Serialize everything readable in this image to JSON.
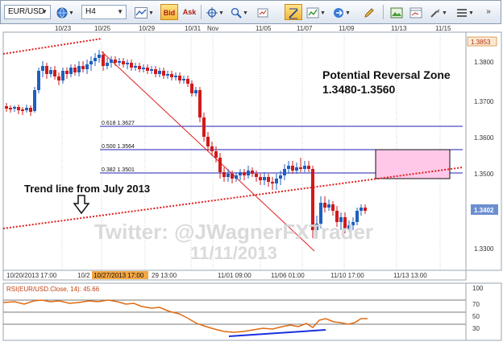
{
  "toolbar": {
    "symbol": "EUR/USD",
    "timeframe": "H4",
    "bid_label": "Bid",
    "ask_label": "Ask"
  },
  "top_dates": [
    "10/23",
    "10/25",
    "10/29",
    "10/31",
    "Nov",
    "11/05",
    "11/07",
    "11/09",
    "11/13",
    "11/15"
  ],
  "price_axis": {
    "labels": [
      "1.3853",
      "1.3800",
      "1.3700",
      "1.3600",
      "1.3500",
      "1.3402",
      "1.3300"
    ],
    "current": "1.3402"
  },
  "bottom_dates": [
    "10/20/2013 17:00",
    "10/2",
    "10/27/2013 17:00",
    "29 13:00",
    "11/01 09:00",
    "11/06 01:00",
    "11/10 17:00",
    "11/13 13:00"
  ],
  "annotations": {
    "zone_title": "Potential Reversal Zone",
    "zone_range": "1.3480-1.3560",
    "trend_label": "Trend line from July 2013",
    "watermark_line1": "Twitter: @JWagnerFXTrader",
    "watermark_line2": "11/11/2013"
  },
  "fib_levels": [
    {
      "label": "0.618  1.3627"
    },
    {
      "label": "0.500  1.3564"
    },
    {
      "label": "0.382  1.3501"
    }
  ],
  "rsi": {
    "label": "RSI(EUR/USD.Close, 14): 45.66",
    "axis_labels": [
      "100",
      "70",
      "50",
      "30"
    ]
  },
  "colors": {
    "up_candle": "#1f5fbf",
    "down_candle": "#d11a1a",
    "fib_line": "#1f1fb5",
    "zone_fill": "#ffc8e8",
    "trend_dotted": "#e0201e",
    "rsi_line": "#e06a10",
    "rsi_trend": "#1a2fe0",
    "price_badge": "#6b8fd0"
  }
}
